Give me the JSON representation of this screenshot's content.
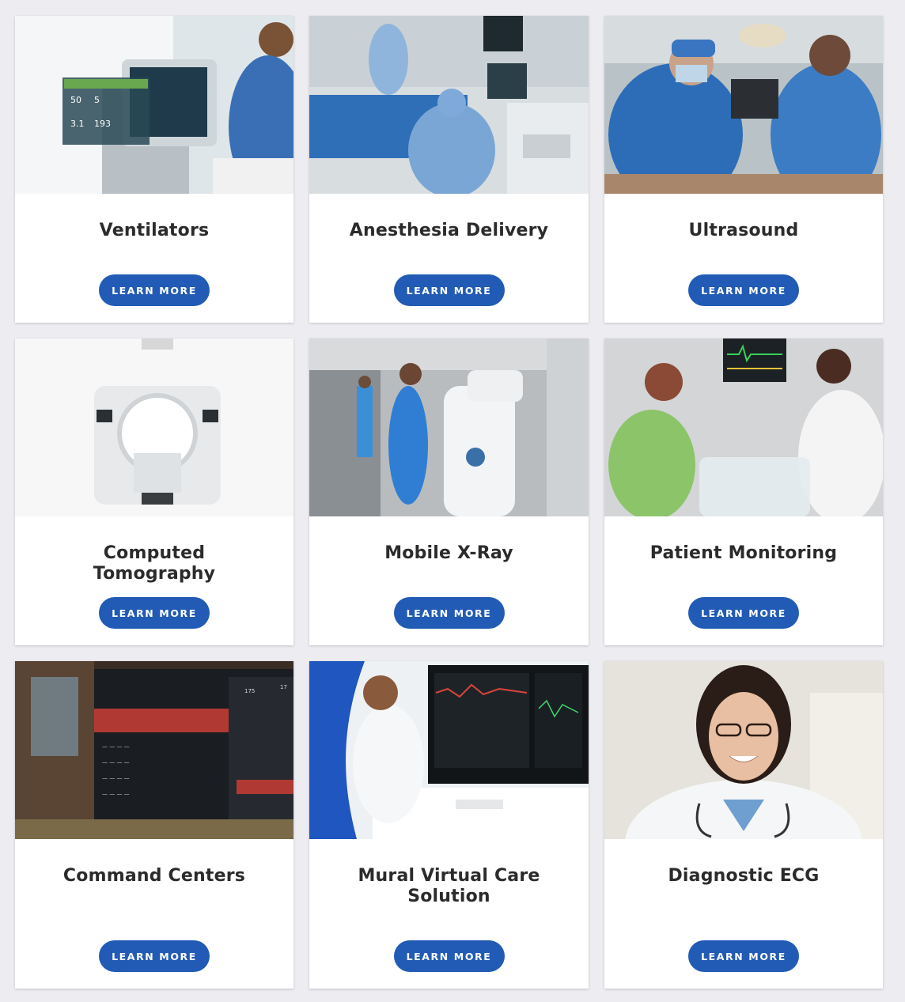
{
  "cards": [
    {
      "title": "Ventilators",
      "button": "LEARN MORE",
      "image": "ventilator-photo"
    },
    {
      "title": "Anesthesia Delivery",
      "button": "LEARN MORE",
      "image": "anesthesia-photo"
    },
    {
      "title": "Ultrasound",
      "button": "LEARN MORE",
      "image": "ultrasound-photo"
    },
    {
      "title": "Computed Tomography",
      "button": "LEARN MORE",
      "image": "ct-scanner-photo"
    },
    {
      "title": "Mobile X-Ray",
      "button": "LEARN MORE",
      "image": "mobile-xray-photo"
    },
    {
      "title": "Patient Monitoring",
      "button": "LEARN MORE",
      "image": "patient-monitoring-photo"
    },
    {
      "title": "Command Centers",
      "button": "LEARN MORE",
      "image": "command-center-photo"
    },
    {
      "title": "Mural Virtual Care Solution",
      "button": "LEARN MORE",
      "image": "mural-virtual-care-photo"
    },
    {
      "title": "Diagnostic ECG",
      "button": "LEARN MORE",
      "image": "diagnostic-ecg-photo"
    }
  ],
  "colors": {
    "button": "#215bb5",
    "page_bg": "#ececf1",
    "title": "#2b2b2b"
  }
}
